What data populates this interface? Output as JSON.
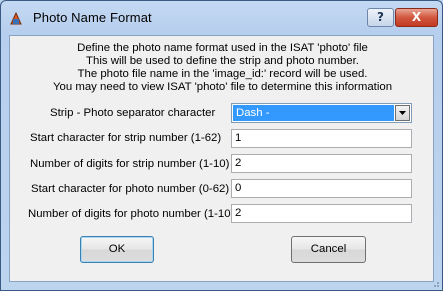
{
  "window": {
    "title": "Photo Name Format",
    "help_symbol": "?",
    "close_symbol": "X"
  },
  "description": [
    "Define the photo name format used in the ISAT 'photo' file",
    "This will be used to define the strip and photo number.",
    "The photo file name in the 'image_id:' record will be used.",
    "You may need to view ISAT 'photo' file to determine this information"
  ],
  "form": {
    "separator": {
      "label": "Strip - Photo separator character",
      "value": "Dash -"
    },
    "strip_start": {
      "label": "Start character for strip number (1-62)",
      "value": "1"
    },
    "strip_digits": {
      "label": "Number of digits for strip number (1-10)",
      "value": "2"
    },
    "photo_start": {
      "label": "Start character for photo number (0-62)",
      "value": "0"
    },
    "photo_digits": {
      "label": "Number of digits for photo number (1-10)",
      "value": "2"
    }
  },
  "buttons": {
    "ok": "OK",
    "cancel": "Cancel"
  },
  "colors": {
    "selection": "#3399ff",
    "close_button": "#c33a22",
    "client_bg": "#f0f0f0",
    "frame": "#bcd3ee"
  },
  "icons": {
    "app": "app-icon",
    "help": "help-icon",
    "close": "close-icon",
    "dropdown": "chevron-down-icon"
  }
}
